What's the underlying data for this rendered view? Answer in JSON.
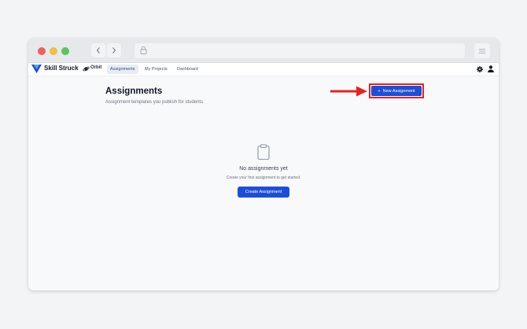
{
  "app": {
    "brand": "Skill Struck",
    "product": "Orbit",
    "tabs": [
      {
        "label": "Assignments",
        "active": true
      },
      {
        "label": "My Projects",
        "active": false
      },
      {
        "label": "Dashboard",
        "active": false
      }
    ]
  },
  "page": {
    "title": "Assignments",
    "subtitle": "Assignment templates you publish for students",
    "new_button": {
      "icon": "+",
      "label": "New Assignment"
    }
  },
  "empty_state": {
    "title": "No assignments yet",
    "subtitle": "Create your first assignment to get started.",
    "button": "Create Assignment"
  },
  "colors": {
    "accent": "#1d4ed8",
    "highlight": "#e8221a"
  }
}
